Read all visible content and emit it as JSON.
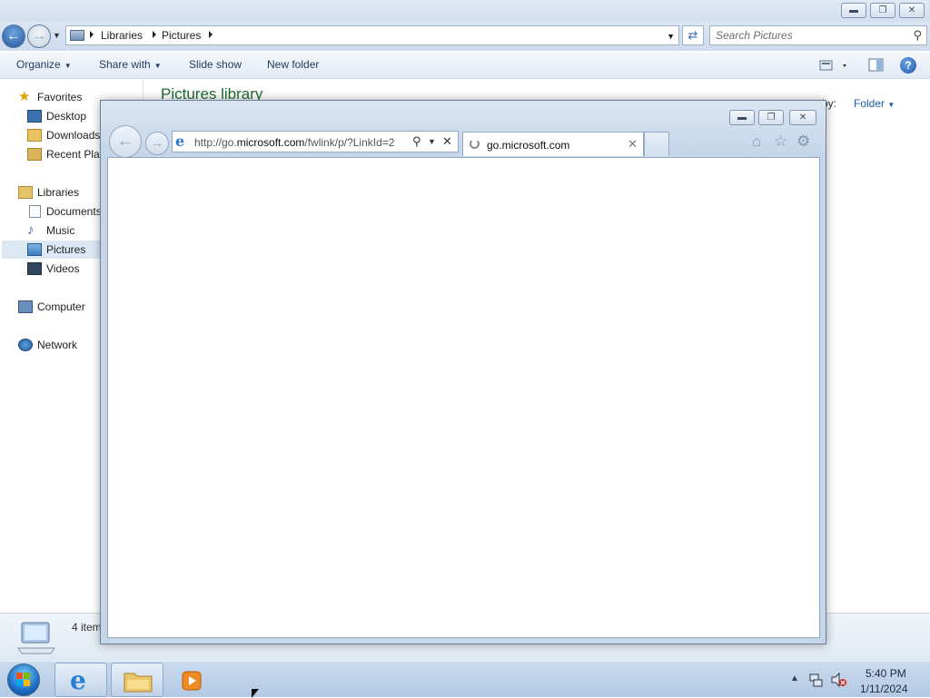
{
  "explorer": {
    "breadcrumbs": [
      "Libraries",
      "Pictures"
    ],
    "search_placeholder": "Search Pictures",
    "toolbar": {
      "organize": "Organize",
      "share_with": "Share with",
      "slide_show": "Slide show",
      "new_folder": "New folder"
    },
    "nav": {
      "favorites": "Favorites",
      "desktop": "Desktop",
      "downloads": "Downloads",
      "recent_places": "Recent Plac",
      "libraries": "Libraries",
      "documents": "Documents",
      "music": "Music",
      "pictures": "Pictures",
      "videos": "Videos",
      "computer": "Computer",
      "network": "Network"
    },
    "library_title": "Pictures library",
    "arrange_by_label": "by:",
    "arrange_by_value": "Folder",
    "details_text": "4 item"
  },
  "ie": {
    "url_prefix": "http://go.",
    "url_domain": "microsoft.com",
    "url_suffix": "/fwlink/p/?LinkId=2",
    "tab_title": "go.microsoft.com"
  },
  "taskbar": {
    "clock_time": "5:40 PM",
    "clock_date": "1/11/2024"
  },
  "colors": {
    "accent": "#1e6b30",
    "link": "#1e5ba6"
  },
  "icons": [
    "back-arrow-icon",
    "forward-arrow-icon",
    "refresh-icon",
    "search-icon",
    "help-icon",
    "home-icon",
    "favorites-star-icon",
    "gear-icon",
    "close-icon",
    "minimize-icon",
    "restore-icon",
    "start-orb-icon",
    "internet-explorer-icon",
    "file-explorer-icon",
    "media-player-icon",
    "network-tray-icon",
    "volume-muted-tray-icon"
  ]
}
